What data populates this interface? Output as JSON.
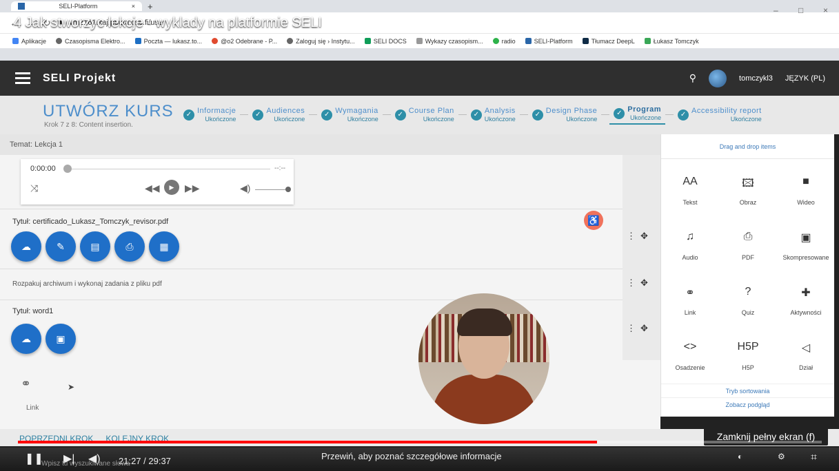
{
  "video": {
    "title": "4 Jak stworzyc lekcje - wyklady na platformie SELI",
    "time": "21:27 / 29:37",
    "progress": 0.72,
    "hint": "Przewiń, aby poznać szczegółowe informacje",
    "tooltip": "Zamknij pełny ekran (f)",
    "search": "Wpisz tu wyszukiwane słowa"
  },
  "browser": {
    "tab": "SELI-Platform",
    "url": "vm2161.kaj.pouta.csc.fi/user",
    "bookmarks": [
      "Aplikacje",
      "Czasopisma Elektro...",
      "Poczta — lukasz.to...",
      "@o2 Odebrane - P...",
      "Zaloguj się › Instytu...",
      "SELI DOCS",
      "Wykazy czasopism...",
      "radio",
      "SELI-Platform",
      "Tłumacz DeepL",
      "Łukasz Tomczyk"
    ]
  },
  "app": {
    "title": "SELI Projekt",
    "user": "tomczykl3",
    "lang": "JĘZYK (PL)"
  },
  "course": {
    "heading": "UTWÓRZ KURS",
    "step": "Krok 7 z 8: Content insertion.",
    "steps": [
      {
        "name": "Informacje",
        "status": "Ukończone"
      },
      {
        "name": "Audiences",
        "status": "Ukończone"
      },
      {
        "name": "Wymagania",
        "status": "Ukończone"
      },
      {
        "name": "Course Plan",
        "status": "Ukończone"
      },
      {
        "name": "Analysis",
        "status": "Ukończone"
      },
      {
        "name": "Design Phase",
        "status": "Ukończone"
      },
      {
        "name": "Program",
        "status": "Ukończone"
      },
      {
        "name": "Accessibility report",
        "status": "Ukończone"
      }
    ]
  },
  "lesson": {
    "topic": "Temat: Lekcja 1",
    "audio_time": "0:00:00",
    "audio_end": "--:--",
    "pdf_title": "Tytuł: certificado_Lukasz_Tomczyk_revisor.pdf",
    "text": "Rozpakuj archiwum i wykonaj zadania z pliku pdf",
    "word_title": "Tytuł: word1",
    "link_label": "Link"
  },
  "panel": {
    "header": "Drag and drop items",
    "items": [
      {
        "label": "Tekst",
        "icon": "AA"
      },
      {
        "label": "Obraz",
        "icon": "🖾"
      },
      {
        "label": "Wideo",
        "icon": "■"
      },
      {
        "label": "Audio",
        "icon": "♫"
      },
      {
        "label": "PDF",
        "icon": "⎙"
      },
      {
        "label": "Skompresowane",
        "icon": "▣"
      },
      {
        "label": "Link",
        "icon": "⚭"
      },
      {
        "label": "Quiz",
        "icon": "?"
      },
      {
        "label": "Aktywności",
        "icon": "✚"
      },
      {
        "label": "Osadzenie",
        "icon": "<>"
      },
      {
        "label": "H5P",
        "icon": "H5P"
      },
      {
        "label": "Dział",
        "icon": "◁"
      }
    ],
    "sort": "Tryb sortowania",
    "preview": "Zobacz podgląd"
  },
  "nav": {
    "prev": "POPRZEDNI KROK",
    "next": "KOLEJNY KROK"
  }
}
